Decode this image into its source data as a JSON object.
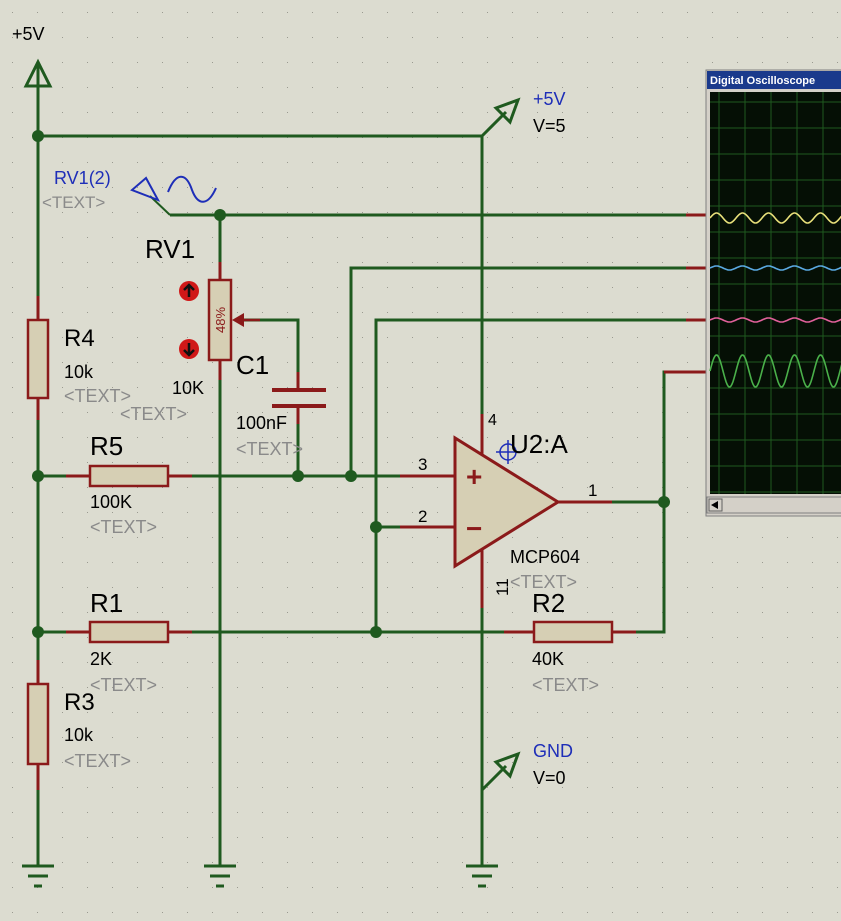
{
  "colors": {
    "background": "#dcdcd0",
    "wire": "#1f5a1f",
    "component": "#8b1a1a",
    "component_fill": "#d6cfb4",
    "label": "#000000",
    "label_blue": "#1e2eb8",
    "placeholder": "#8a8a8a",
    "scope_title_bg": "#1a3a8c",
    "scope_screen": "#050f05",
    "scope_grid": "#1f5a1f",
    "trace_yellow": "#e8e07a",
    "trace_blue": "#5aa8e0",
    "trace_pink": "#e0609a",
    "trace_green": "#4ab04a"
  },
  "power": {
    "vcc_label": "+5V",
    "vcc2_label": "+5V",
    "vcc2_value": "V=5",
    "gnd_label": "GND",
    "gnd_value": "V=0"
  },
  "probe": {
    "name": "RV1(2)",
    "text": "<TEXT>"
  },
  "components": {
    "r4": {
      "ref": "R4",
      "value": "10k",
      "text": "<TEXT>"
    },
    "rv1": {
      "ref": "RV1",
      "value": "10K",
      "percent": "48%",
      "text": "<TEXT>"
    },
    "c1": {
      "ref": "C1",
      "value": "100nF",
      "text": "<TEXT>"
    },
    "r5": {
      "ref": "R5",
      "value": "100K",
      "text": "<TEXT>"
    },
    "r1": {
      "ref": "R1",
      "value": "2K",
      "text": "<TEXT>"
    },
    "r3": {
      "ref": "R3",
      "value": "10k",
      "text": "<TEXT>"
    },
    "r2": {
      "ref": "R2",
      "value": "40K",
      "text": "<TEXT>"
    },
    "u2": {
      "ref": "U2:A",
      "part": "MCP604",
      "text": "<TEXT>",
      "pin_vdd": "4",
      "pin_noninv": "3",
      "pin_inv": "2",
      "pin_out": "1",
      "pin_vss": "11",
      "plus": "+",
      "minus": "−"
    }
  },
  "oscilloscope": {
    "title": "Digital Oscilloscope"
  }
}
